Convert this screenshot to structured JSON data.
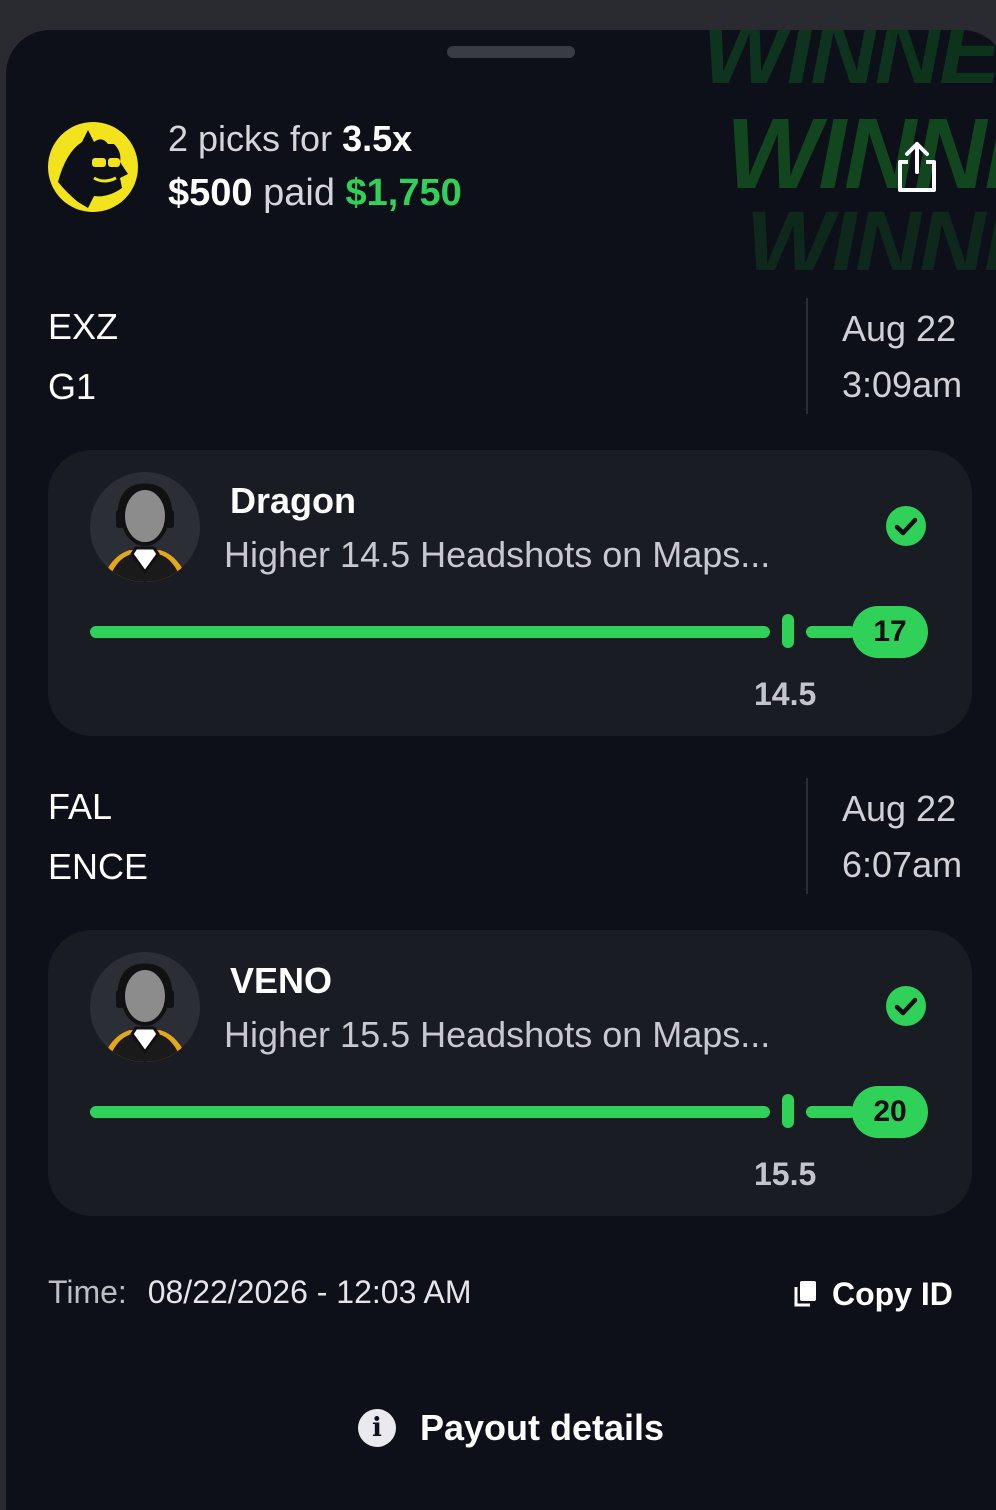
{
  "header": {
    "picks_prefix": "2 picks for",
    "multiplier": "3.5x",
    "entry_amount": "$500",
    "paid_label": "paid",
    "paid_amount": "$1,750",
    "winner_text": "WINNER!",
    "colors": {
      "accent_green": "#2fd159",
      "brand_yellow": "#f2e31c",
      "background": "#0d0f19"
    }
  },
  "matches": [
    {
      "team1": "EXZ",
      "team2": "G1",
      "date": "Aug 22",
      "time": "3:09am",
      "pick": {
        "player": "Dragon",
        "description": "Higher 14.5 Headshots on Maps...",
        "line": "14.5",
        "result": "17",
        "status": "won"
      }
    },
    {
      "team1": "FAL",
      "team2": "ENCE",
      "date": "Aug 22",
      "time": "6:07am",
      "pick": {
        "player": "VENO",
        "description": "Higher 15.5 Headshots on Maps...",
        "line": "15.5",
        "result": "20",
        "status": "won"
      }
    }
  ],
  "footer": {
    "time_label": "Time:",
    "time_value": "08/22/2026 - 12:03 AM",
    "copy_id_label": "Copy ID",
    "payout_details_label": "Payout details"
  },
  "icons": [
    "share-icon",
    "check-icon",
    "copy-icon",
    "info-icon",
    "logo-icon",
    "player-avatar-icon"
  ]
}
